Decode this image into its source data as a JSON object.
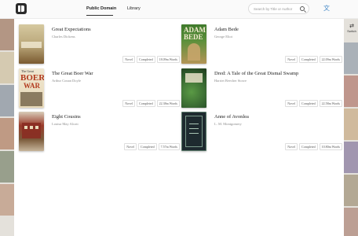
{
  "app": {
    "logo_name": "app-logo"
  },
  "nav": {
    "tabs": [
      {
        "label": "Public Domain",
        "active": true
      },
      {
        "label": "Library",
        "active": false
      }
    ]
  },
  "search": {
    "placeholder": "Search by Title or Author"
  },
  "side": {
    "switch_label": "Switch"
  },
  "books": [
    {
      "title": "Great Expectations",
      "author": "Charles Dickens",
      "tags": [
        "Novel",
        "Completed",
        "18.09m Words"
      ],
      "cover_colors": [
        "#c8b88e",
        "#8a6a3a"
      ]
    },
    {
      "title": "Adam Bede",
      "author": "George Eliot",
      "tags": [
        "Novel",
        "Completed",
        "22.09m Words"
      ],
      "cover_colors": [
        "#3f7a2c",
        "#c0a15a"
      ],
      "cover_text": [
        "ADAM",
        "BEDE"
      ]
    },
    {
      "title": "The Great Boer War",
      "author": "Arthur Conan Doyle",
      "tags": [
        "Novel",
        "Completed",
        "22.38m Words"
      ],
      "cover_colors": [
        "#b23a1e",
        "#efe6d0"
      ],
      "cover_text": [
        "The Great",
        "BOER",
        "WAR"
      ]
    },
    {
      "title": "Dred: A Tale of the Great Dismal Swamp",
      "author": "Harriet Beecher Stowe",
      "tags": [
        "Novel",
        "Completed",
        "22.58m Words"
      ],
      "cover_colors": [
        "#2f5a2c",
        "#4f8a3a"
      ]
    },
    {
      "title": "Eight Cousins",
      "author": "Louisa May Alcott",
      "tags": [
        "Novel",
        "Completed",
        "7.57m Words"
      ],
      "cover_colors": [
        "#9a3a2a",
        "#c6b49a"
      ]
    },
    {
      "title": "Anne of Avonlea",
      "author": "L. M. Montgomery",
      "tags": [
        "Novel",
        "Completed",
        "10.80m Words"
      ],
      "cover_colors": [
        "#1e2a2f",
        "#5a7a6a"
      ]
    }
  ]
}
